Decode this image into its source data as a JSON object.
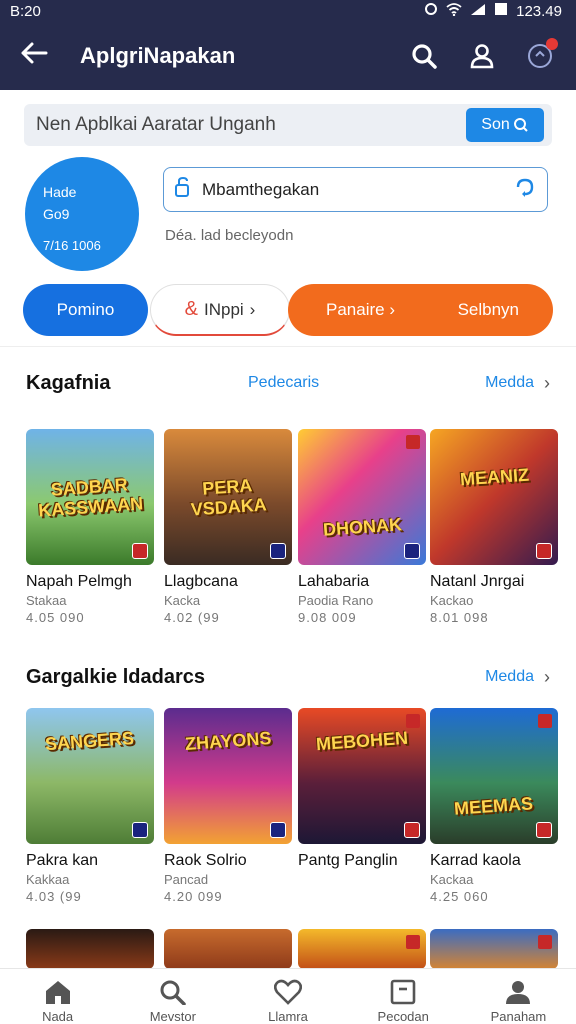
{
  "status": {
    "time": "B:20",
    "clock": "123.49"
  },
  "appbar": {
    "title": "AplgriNapakan"
  },
  "search": {
    "placeholder": "Nen Apblkai Aaratar Unganh",
    "button": "Son"
  },
  "profile": {
    "line1": "Hade",
    "line2": "Go9",
    "line3": "7/16 1006"
  },
  "field": {
    "value": "Mbamthegakan",
    "hint": "Déa. lad becleyodn"
  },
  "pills": {
    "primary": "Pomino",
    "outline": "INppi",
    "orange_left": "Panaire",
    "orange_right": "Selbnyn"
  },
  "sections": [
    {
      "title": "Kagafnia",
      "middle": "Pedecaris",
      "more": "Medda",
      "items": [
        {
          "art": "SADBAR KASSWAAN",
          "name": "Napah Pelmgh",
          "sub": "Stakaa",
          "rating": "4.05 090"
        },
        {
          "art": "PERA VSDAKA",
          "name": "Llagbcana",
          "sub": "Kacka",
          "rating": "4.02 (99"
        },
        {
          "art": "DHONAK",
          "name": "Lahabaria",
          "sub": "Paodia Rano",
          "rating": "9.08 009"
        },
        {
          "art": "MEANIZ",
          "name": "Natanl Jnrgai",
          "sub": "Kackao",
          "rating": "8.01 098"
        }
      ]
    },
    {
      "title": "Gargalkie ldadarcs",
      "more": "Medda",
      "items": [
        {
          "art": "SANGERS",
          "name": "Pakra kan",
          "sub": "Kakkaa",
          "rating": "4.03 (99"
        },
        {
          "art": "ZHAYONS",
          "name": "Raok Solrio",
          "sub": "Pancad",
          "rating": "4.20 099"
        },
        {
          "art": "MEBOHEN",
          "name": "Pantg Panglin",
          "sub": "",
          "rating": ""
        },
        {
          "art": "MEEMAS",
          "name": "Karrad kaola",
          "sub": "Kackaa",
          "rating": "4.25 060"
        }
      ]
    }
  ],
  "nav": [
    "Nada",
    "Mevstor",
    "Llamra",
    "Pecodan",
    "Panaham"
  ],
  "colors": {
    "header": "#262b4c",
    "accent": "#1e88e5",
    "orange": "#f26b1d"
  }
}
